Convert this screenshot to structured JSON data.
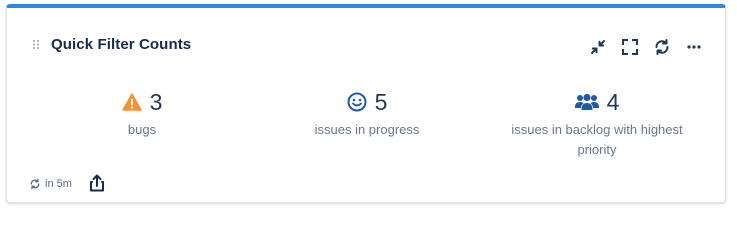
{
  "gadget": {
    "title": "Quick Filter Counts"
  },
  "toolbar": {
    "icons": [
      "minimize-icon",
      "fullscreen-icon",
      "refresh-icon",
      "more-icon"
    ]
  },
  "stats": [
    {
      "count": "3",
      "label": "bugs",
      "icon": "warning-icon",
      "icon_color": "#f79232"
    },
    {
      "count": "5",
      "label": "issues in progress",
      "icon": "smiley-icon",
      "icon_color": "#1e5aa8"
    },
    {
      "count": "4",
      "label": "issues in backlog with highest priority",
      "icon": "users-icon",
      "icon_color": "#1e5aa8"
    }
  ],
  "footer": {
    "refresh_text": "in 5m",
    "icons": [
      "auto-refresh-icon",
      "share-icon"
    ]
  },
  "colors": {
    "accent": "#2f87e4",
    "title": "#172b4d",
    "muted": "#6b778c"
  }
}
